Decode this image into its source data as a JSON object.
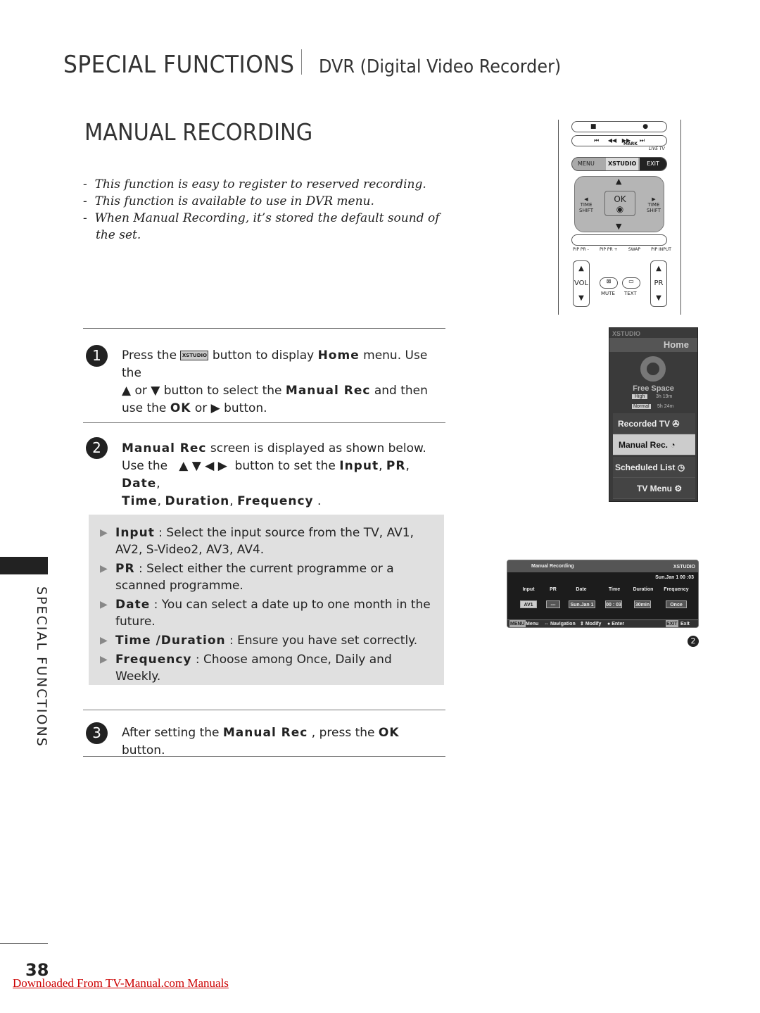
{
  "header": {
    "section": "SPECIAL FUNCTIONS",
    "subsection": "DVR (Digital Video Recorder)"
  },
  "title": "MANUAL RECORDING",
  "intro": [
    "This function is easy to register to reserved recording.",
    "This function is available to use in DVR menu.",
    "When Manual Recording, it’s stored the default sound of the set."
  ],
  "steps": [
    {
      "number": "1",
      "parts": [
        "Press the",
        "button to display",
        "Home",
        "menu. Use the",
        "▲ or ▼ button to select the",
        "Manual Rec",
        "and then use the",
        "OK",
        "or ▶ button."
      ],
      "icon_label": "XSTUDIO"
    },
    {
      "number": "2",
      "parts": [
        "Manual Rec",
        "screen is displayed as shown below.",
        "Use the",
        "▲ ▼ ◀ ▶",
        "button to set the",
        "Input",
        "PR",
        "Date",
        "Time",
        "Duration",
        "Frequency"
      ]
    },
    {
      "number": "3",
      "parts": [
        "After setting the",
        "Manual Rec",
        ", press the",
        "OK",
        "button."
      ]
    }
  ],
  "options": [
    {
      "term": "Input",
      "desc": ": Select the input source from the TV, AV1, AV2, S-Video2, AV3, AV4."
    },
    {
      "term": "PR",
      "desc": ": Select either the current programme or a scanned programme."
    },
    {
      "term": "Date",
      "desc": ": You can select a date up to one month in the future."
    },
    {
      "term": "Time /Duration",
      "desc": ": Ensure you have set correctly."
    },
    {
      "term": "Frequency",
      "desc": ": Choose among Once, Daily and Weekly."
    }
  ],
  "side_tab": "SPECIAL FUNCTIONS",
  "page_number": "38",
  "footer_link": "Downloaded From TV-Manual.com Manuals",
  "remote": {
    "labels": {
      "mark": "MARK",
      "live_tv": "LIVE TV",
      "menu": "MENU",
      "xstudio": "XSTUDIO",
      "exit": "EXIT",
      "ok": "OK",
      "time_shift_left": "TIME SHIFT",
      "time_shift_right": "TIME SHIFT",
      "pip_pr_minus": "PIP PR -",
      "pip_pr_plus": "PIP PR +",
      "swap": "SWAP",
      "pip_input": "PIP INPUT",
      "vol": "VOL",
      "pr": "PR",
      "mute": "MUTE",
      "text": "TEXT"
    }
  },
  "home_menu": {
    "brand": "XSTUDIO",
    "title": "Home",
    "free_space": "Free Space",
    "quality": [
      {
        "label": "High",
        "time": "3h  19m"
      },
      {
        "label": "Normal",
        "time": "5h  24m"
      }
    ],
    "items": [
      {
        "label": "Recorded TV",
        "icon": "film-reel-icon"
      },
      {
        "label": "Manual Rec.",
        "icon": "clock-record-icon",
        "selected": true
      },
      {
        "label": "Scheduled List",
        "icon": "schedule-clock-icon"
      },
      {
        "label": "TV Menu",
        "icon": "gears-icon"
      }
    ]
  },
  "manual_rec_screen": {
    "title": "Manual Recording",
    "brand": "XSTUDIO",
    "datetime": "Sun.Jan 1   00 :03",
    "columns": [
      "Input",
      "PR",
      "Date",
      "Time",
      "Duration",
      "Frequency"
    ],
    "values": [
      "AV1",
      "---",
      "Sun.Jan 1",
      "00 : 03",
      "30min",
      "Once"
    ],
    "footer": [
      "MENU",
      "Menu",
      "Navigation",
      "Modify",
      "Enter",
      "EXIT",
      "Exit"
    ],
    "badge": "2"
  }
}
